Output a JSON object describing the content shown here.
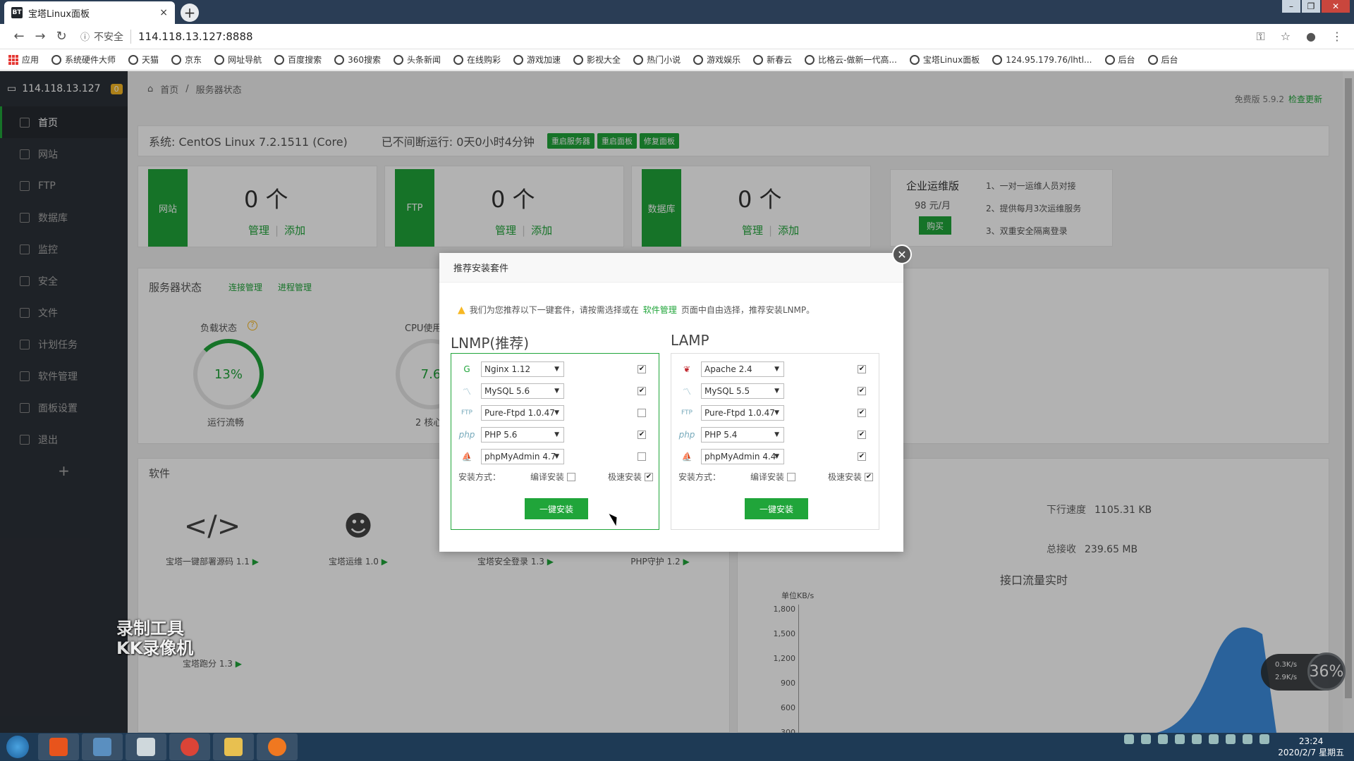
{
  "browser": {
    "tab_title": "宝塔Linux面板",
    "tab_close": "×",
    "new_tab": "+",
    "insecure": "不安全",
    "url": "114.118.13.127:8888"
  },
  "bookmarks": [
    "应用",
    "系统硬件大师",
    "天猫",
    "京东",
    "网址导航",
    "百度搜索",
    "360搜索",
    "头条新闻",
    "在线购彩",
    "游戏加速",
    "影视大全",
    "热门小说",
    "游戏娱乐",
    "新春云",
    "比格云-做新一代高...",
    "宝塔Linux面板",
    "124.95.179.76/lhtl...",
    "后台",
    "后台"
  ],
  "sidebar": {
    "ip": "114.118.13.127",
    "badge": "0",
    "items": [
      {
        "label": "首页"
      },
      {
        "label": "网站"
      },
      {
        "label": "FTP"
      },
      {
        "label": "数据库"
      },
      {
        "label": "监控"
      },
      {
        "label": "安全"
      },
      {
        "label": "文件"
      },
      {
        "label": "计划任务"
      },
      {
        "label": "软件管理"
      },
      {
        "label": "面板设置"
      },
      {
        "label": "退出"
      }
    ],
    "plus": "+"
  },
  "breadcrumb": {
    "home": "首页",
    "sep": "/",
    "current": "服务器状态"
  },
  "version": {
    "text": "免费版 5.9.2",
    "check": "检查更新"
  },
  "system": {
    "os": "系统: CentOS Linux 7.2.1511 (Core)",
    "uptime": "已不间断运行: 0天0小时4分钟",
    "restart_server": "重启服务器",
    "restart_panel": "重启面板",
    "repair_panel": "修复面板"
  },
  "stats": [
    {
      "label": "网站",
      "count": "0 个",
      "manage": "管理",
      "add": "添加"
    },
    {
      "label": "FTP",
      "count": "0 个",
      "manage": "管理",
      "add": "添加"
    },
    {
      "label": "数据库",
      "count": "0 个",
      "manage": "管理",
      "add": "添加"
    }
  ],
  "enterprise": {
    "title": "企业运维版",
    "price": "98 元/月",
    "buy": "购买",
    "features": [
      "1、一对一运维人员对接",
      "2、提供每月3次运维服务",
      "3、双重安全隔离登录"
    ]
  },
  "server_status": {
    "title": "服务器状态",
    "conn": "连接管理",
    "proc": "进程管理",
    "load_label": "负载状态",
    "load_value": "13%",
    "load_text": "运行流畅",
    "cpu_label": "CPU使用",
    "cpu_value": "7.6",
    "cpu_text": "2 核心"
  },
  "software": {
    "title": "软件",
    "items": [
      {
        "name": "宝塔一键部署源码 1.1"
      },
      {
        "name": "宝塔运维 1.0"
      },
      {
        "name": "宝塔安全登录 1.3"
      },
      {
        "name": "PHP守护 1.2"
      }
    ],
    "extra": "宝塔跑分 1.3"
  },
  "network": {
    "download_label": "下行速度",
    "download": "1105.31 KB",
    "recv_label": "总接收",
    "recv": "239.65 MB",
    "chart_title": "接口流量实时",
    "unit": "单位KB/s",
    "yticks": [
      "1,800",
      "1,500",
      "1,200",
      "900",
      "600",
      "300"
    ]
  },
  "float_widget": {
    "up": "0.3K/s",
    "down": "2.9K/s",
    "percent": "36%"
  },
  "watermark": [
    "录制工具",
    "KK录像机"
  ],
  "modal": {
    "title": "推荐安装套件",
    "notice_pre": "我们为您推荐以下一键套件，请按需选择或在",
    "notice_link": "软件管理",
    "notice_post": "页面中自由选择，推荐安装LNMP。",
    "suites": [
      {
        "name": "LNMP(推荐)",
        "items": [
          {
            "icon": "nginx",
            "value": "Nginx 1.12",
            "checked": "✔"
          },
          {
            "icon": "mysql",
            "value": "MySQL 5.6",
            "checked": "✔"
          },
          {
            "icon": "ftp",
            "value": "Pure-Ftpd 1.0.47",
            "checked": ""
          },
          {
            "icon": "php",
            "value": "PHP 5.6",
            "checked": "✔"
          },
          {
            "icon": "phpmyadmin",
            "value": "phpMyAdmin 4.7",
            "checked": ""
          }
        ],
        "mode_label": "安装方式：",
        "compile": "编译安装",
        "fast": "极速安装",
        "fast_checked": "✔",
        "compile_checked": "",
        "install": "一键安装"
      },
      {
        "name": "LAMP",
        "items": [
          {
            "icon": "apache",
            "value": "Apache 2.4",
            "checked": "✔"
          },
          {
            "icon": "mysql",
            "value": "MySQL 5.5",
            "checked": "✔"
          },
          {
            "icon": "ftp",
            "value": "Pure-Ftpd 1.0.47",
            "checked": "✔"
          },
          {
            "icon": "php",
            "value": "PHP 5.4",
            "checked": "✔"
          },
          {
            "icon": "phpmyadmin",
            "value": "phpMyAdmin 4.4",
            "checked": "✔"
          }
        ],
        "mode_label": "安装方式：",
        "compile": "编译安装",
        "fast": "极速安装",
        "fast_checked": "✔",
        "compile_checked": "",
        "install": "一键安装"
      }
    ]
  },
  "clock": {
    "time": "23:24",
    "date": "2020/2/7 星期五"
  }
}
